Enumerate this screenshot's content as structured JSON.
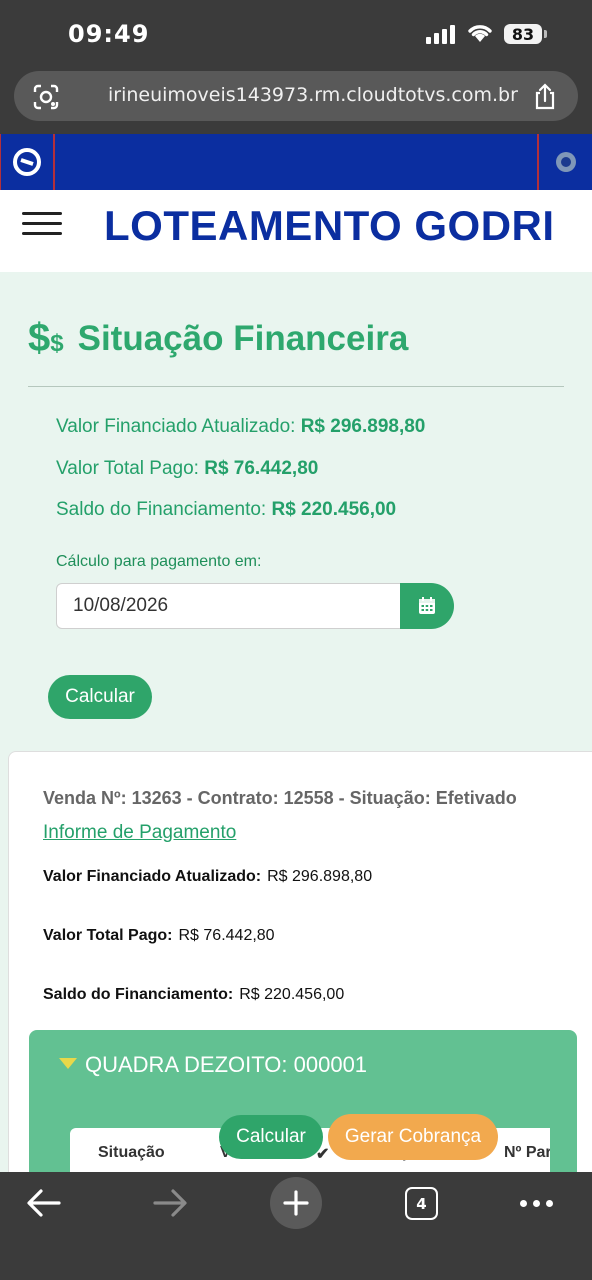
{
  "status_bar": {
    "time": "09:49",
    "battery": "83"
  },
  "browser": {
    "url": "irineuimoveis143973.rm.cloudtotvs.com.br",
    "open_tabs": "4"
  },
  "header": {
    "app_title": "LOTEAMENTO GODRI",
    "brand_color": "#0b2ea0"
  },
  "financial": {
    "icon_label": "$",
    "icon_small": "$",
    "title": "Situação Financeira",
    "summary": [
      {
        "label": "Valor Financiado Atualizado:",
        "value": "R$ 296.898,80"
      },
      {
        "label": "Valor Total Pago:",
        "value": "R$ 76.442,80"
      },
      {
        "label": "Saldo do Financiamento:",
        "value": "R$ 220.456,00"
      }
    ],
    "calc_label": "Cálculo para pagamento em:",
    "calc_date": "10/08/2026",
    "calc_button": "Calcular",
    "accent_color": "#2fa56a"
  },
  "contract": {
    "header": "Venda Nº: 13263 - Contrato: 12558 - Situação: Efetivado",
    "payment_link": "Informe de Pagamento",
    "details": [
      {
        "label": "Valor Financiado Atualizado:",
        "value": "R$ 296.898,80"
      },
      {
        "label": "Valor Total Pago:",
        "value": "R$ 76.442,80"
      },
      {
        "label": "Saldo do Financiamento:",
        "value": "R$ 220.456,00"
      }
    ],
    "quadra_title": "QUADRA DEZOITO: 000001",
    "table_columns": [
      "Situação",
      "V",
      "p",
      "Nº Par"
    ]
  },
  "floating_actions": {
    "calculate": "Calcular",
    "generate_charge": "Gerar Cobrança",
    "charge_color": "#f2a94e"
  }
}
